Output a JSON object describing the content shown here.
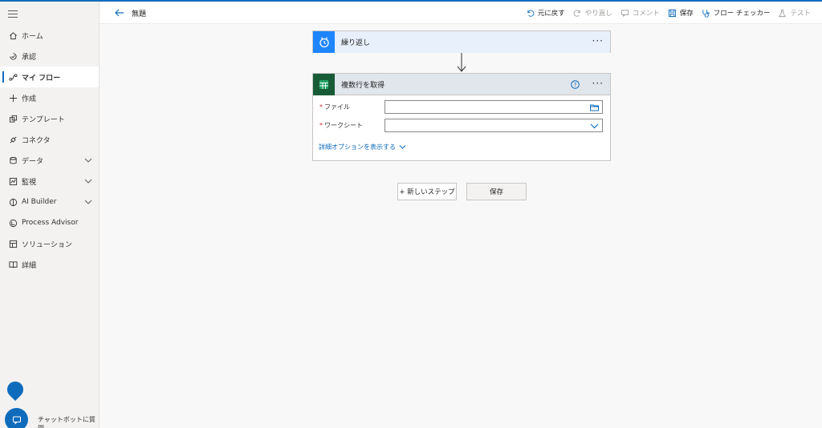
{
  "app": {
    "accent": "#0f6cbd"
  },
  "sidebar": {
    "menu_icon": "hamburger-icon",
    "items": [
      {
        "label": "ホーム",
        "icon": "home-icon"
      },
      {
        "label": "承認",
        "icon": "approvals-icon"
      },
      {
        "label": "マイ フロー",
        "icon": "flow-icon",
        "active": true
      },
      {
        "label": "作成",
        "icon": "plus-icon"
      },
      {
        "label": "テンプレート",
        "icon": "templates-icon"
      },
      {
        "label": "コネクタ",
        "icon": "connector-icon"
      },
      {
        "label": "データ",
        "icon": "database-icon",
        "expandable": true
      },
      {
        "label": "監視",
        "icon": "monitor-icon",
        "expandable": true
      },
      {
        "label": "AI Builder",
        "icon": "ai-builder-icon",
        "expandable": true
      },
      {
        "label": "Process Advisor",
        "icon": "process-advisor-icon"
      },
      {
        "label": "ソリューション",
        "icon": "solutions-icon"
      },
      {
        "label": "詳細",
        "icon": "book-icon"
      }
    ],
    "chatbot_label": "チャットボットに質問"
  },
  "header": {
    "title": "無題",
    "toolbar": {
      "undo": "元に戻す",
      "redo": "やり直し",
      "comment": "コメント",
      "save": "保存",
      "flow_checker": "フロー チェッカー",
      "test": "テスト"
    }
  },
  "canvas": {
    "trigger_card": {
      "title": "繰り返し",
      "icon": "recurrence-clock-icon"
    },
    "action_card": {
      "title": "複数行を取得",
      "icon": "excel-sheets-icon",
      "fields": [
        {
          "label": "ファイル",
          "required": true,
          "value": "",
          "icon": "folder-icon"
        },
        {
          "label": "ワークシート",
          "required": true,
          "value": "",
          "icon": "chevron-down-icon"
        }
      ],
      "advanced_link": "詳細オプションを表示する"
    },
    "new_step_button": "+ 新しいステップ",
    "save_button": "保存"
  }
}
